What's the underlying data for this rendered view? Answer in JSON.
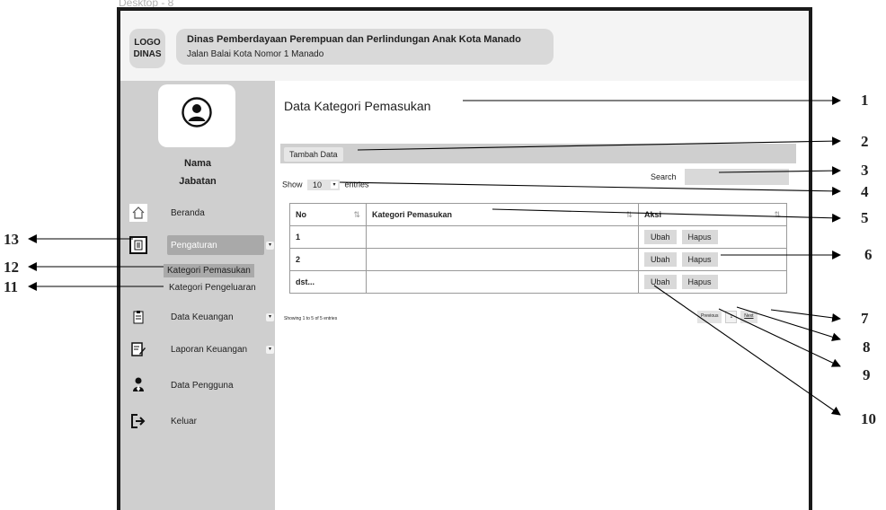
{
  "window": {
    "label": "Desktop - 8"
  },
  "header": {
    "logo": "LOGO DINAS",
    "org_name": "Dinas Pemberdayaan Perempuan dan Perlindungan Anak Kota Manado",
    "address": "Jalan Balai Kota Nomor 1 Manado"
  },
  "user": {
    "name": "Nama",
    "role": "Jabatan"
  },
  "sidebar": {
    "items": [
      {
        "label": "Beranda",
        "icon": "home-icon"
      },
      {
        "label": "Pengaturan",
        "icon": "clipboard-icon"
      },
      {
        "label": "Data Keuangan",
        "icon": "clipboard-icon"
      },
      {
        "label": "Laporan Keuangan",
        "icon": "edit-document-icon"
      },
      {
        "label": "Data Pengguna",
        "icon": "user-icon"
      },
      {
        "label": "Keluar",
        "icon": "logout-icon"
      }
    ],
    "submenu": [
      "Kategori Pemasukan",
      "Kategori  Pengeluaran"
    ]
  },
  "main": {
    "title": "Data Kategori Pemasukan",
    "add_button": "Tambah Data",
    "show_label": "Show",
    "entries_value": "10",
    "entries_label": "entries",
    "search_label": "Search",
    "search_value": "",
    "table": {
      "headers": [
        "No",
        "Kategori Pemasukan",
        "Aksi"
      ],
      "rows": [
        {
          "no": "1",
          "kategori": ""
        },
        {
          "no": "2",
          "kategori": ""
        },
        {
          "no": "dst...",
          "kategori": ""
        }
      ],
      "edit_label": "Ubah",
      "delete_label": "Hapus"
    },
    "info": "Showing 1 to 5 of 5 entries",
    "pager": {
      "previous": "Previous",
      "page": "1",
      "next": "Next"
    }
  },
  "callouts": [
    "1",
    "2",
    "3",
    "4",
    "5",
    "6",
    "7",
    "8",
    "9",
    "10",
    "11",
    "12",
    "13"
  ],
  "colors": {
    "sidebar_bg": "#cfcfcf",
    "active_bg": "#a9a9a9",
    "button_bg": "#d9d9d9"
  }
}
